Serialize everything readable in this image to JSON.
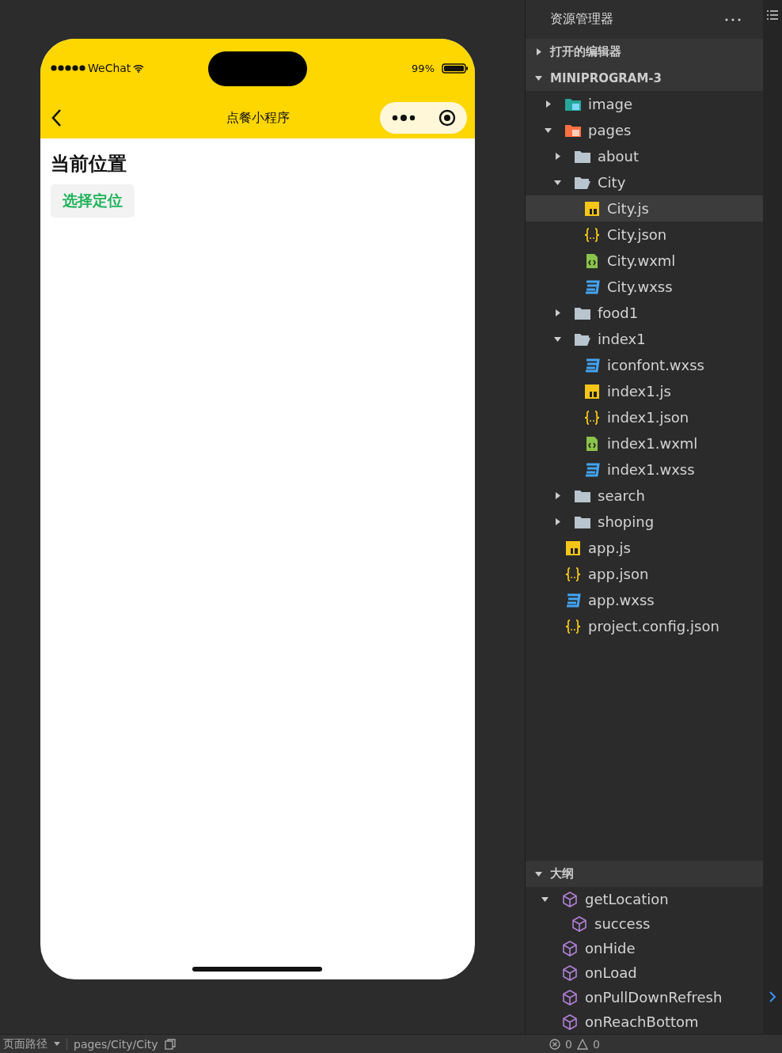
{
  "phone": {
    "carrier": "WeChat",
    "battery": "99%",
    "nav_title": "点餐小程序",
    "heading": "当前位置",
    "button": "选择定位"
  },
  "explorer": {
    "title": "资源管理器",
    "sections": [
      {
        "label": "打开的编辑器",
        "expanded": false
      },
      {
        "label": "MINIPROGRAM-3",
        "expanded": true
      }
    ],
    "tree": [
      {
        "name": "image",
        "kind": "image-folder",
        "expanded": false,
        "selected": false
      },
      {
        "name": "pages",
        "kind": "pages-folder",
        "expanded": true,
        "selected": false,
        "children": [
          {
            "name": "about",
            "kind": "folder",
            "expanded": false,
            "selected": false
          },
          {
            "name": "City",
            "kind": "folder",
            "expanded": true,
            "selected": false,
            "children": [
              {
                "name": "City.js",
                "kind": "js",
                "selected": true
              },
              {
                "name": "City.json",
                "kind": "json",
                "selected": false
              },
              {
                "name": "City.wxml",
                "kind": "wxml",
                "selected": false
              },
              {
                "name": "City.wxss",
                "kind": "wxss",
                "selected": false
              }
            ]
          },
          {
            "name": "food1",
            "kind": "folder",
            "expanded": false,
            "selected": false
          },
          {
            "name": "index1",
            "kind": "folder",
            "expanded": true,
            "selected": false,
            "children": [
              {
                "name": "iconfont.wxss",
                "kind": "wxss",
                "selected": false
              },
              {
                "name": "index1.js",
                "kind": "js",
                "selected": false
              },
              {
                "name": "index1.json",
                "kind": "json",
                "selected": false
              },
              {
                "name": "index1.wxml",
                "kind": "wxml",
                "selected": false
              },
              {
                "name": "index1.wxss",
                "kind": "wxss",
                "selected": false
              }
            ]
          },
          {
            "name": "search",
            "kind": "folder",
            "expanded": false,
            "selected": false
          },
          {
            "name": "shoping",
            "kind": "folder",
            "expanded": false,
            "selected": false
          }
        ]
      },
      {
        "name": "app.js",
        "kind": "js",
        "selected": false
      },
      {
        "name": "app.json",
        "kind": "json",
        "selected": false
      },
      {
        "name": "app.wxss",
        "kind": "wxss",
        "selected": false
      },
      {
        "name": "project.config.json",
        "kind": "json",
        "selected": false
      }
    ]
  },
  "outline": {
    "label": "大纲",
    "expanded": true,
    "items": [
      {
        "name": "getLocation",
        "expanded": true,
        "children": [
          {
            "name": "success"
          }
        ]
      },
      {
        "name": "onHide"
      },
      {
        "name": "onLoad"
      },
      {
        "name": "onPullDownRefresh"
      },
      {
        "name": "onReachBottom"
      }
    ]
  },
  "status_bar": {
    "path_label": "页面路径",
    "path": "pages/City/City",
    "errors": "0",
    "warnings": "0"
  }
}
